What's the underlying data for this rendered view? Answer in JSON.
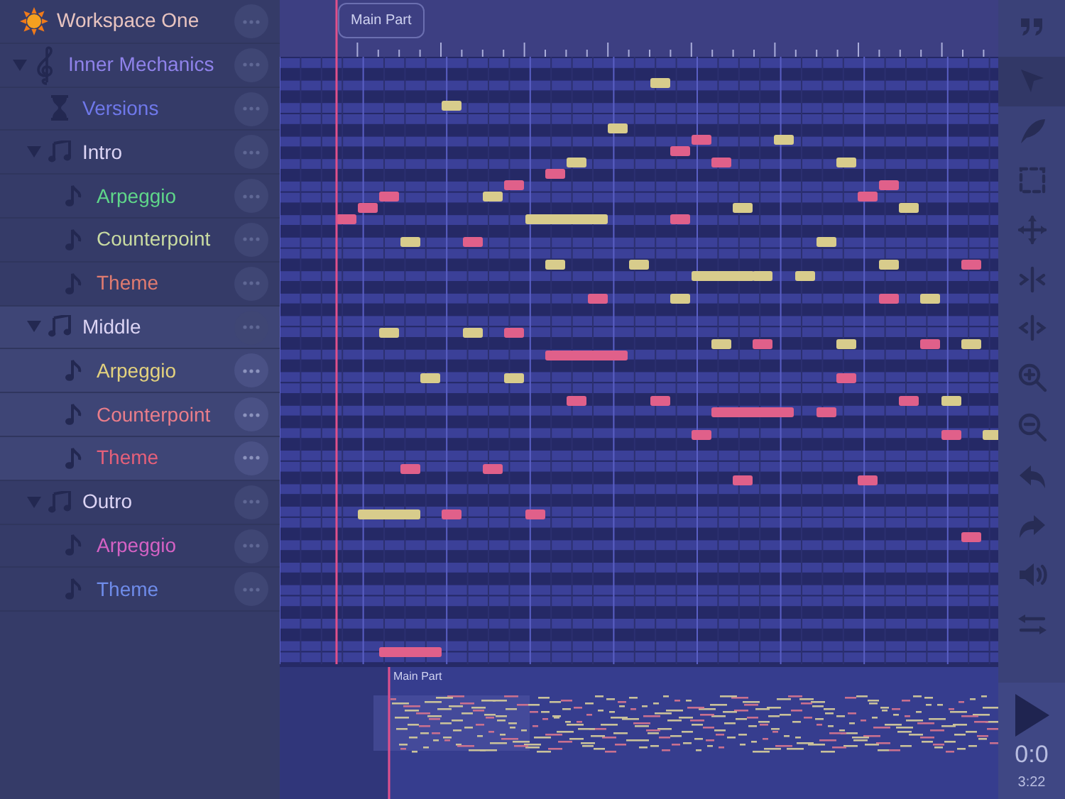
{
  "workspace": {
    "label": "Workspace One"
  },
  "tree": [
    {
      "label": "Inner Mechanics",
      "kind": "project",
      "color": "#8f82ea",
      "expanded": true,
      "children": [
        {
          "label": "Versions",
          "kind": "versions",
          "color": "#6f78ea"
        },
        {
          "label": "Intro",
          "kind": "section",
          "color": "#dcd4f4",
          "expanded": true,
          "selected": false,
          "children": [
            {
              "label": "Arpeggio",
              "kind": "track",
              "color": "#5fd68a"
            },
            {
              "label": "Counterpoint",
              "kind": "track",
              "color": "#c9dba2"
            },
            {
              "label": "Theme",
              "kind": "track",
              "color": "#e07b70"
            }
          ]
        },
        {
          "label": "Middle",
          "kind": "section",
          "color": "#dcd4f4",
          "expanded": true,
          "selected": true,
          "children": [
            {
              "label": "Arpeggio",
              "kind": "track",
              "color": "#e3d27e"
            },
            {
              "label": "Counterpoint",
              "kind": "track",
              "color": "#ea7d8a"
            },
            {
              "label": "Theme",
              "kind": "track",
              "color": "#e5607a"
            }
          ]
        },
        {
          "label": "Outro",
          "kind": "section",
          "color": "#dcd4f4",
          "expanded": true,
          "selected": false,
          "children": [
            {
              "label": "Arpeggio",
              "kind": "track",
              "color": "#d462c4"
            },
            {
              "label": "Theme",
              "kind": "track",
              "color": "#6f8cea"
            }
          ]
        }
      ]
    }
  ],
  "roll": {
    "part_label": "Main Part"
  },
  "overview": {
    "part_label": "Main Part"
  },
  "tools": [
    {
      "kind": "quote",
      "selected": false
    },
    {
      "kind": "pointer",
      "selected": true
    },
    {
      "kind": "pen",
      "selected": false
    },
    {
      "kind": "select",
      "selected": false
    },
    {
      "kind": "move",
      "selected": false
    },
    {
      "kind": "squeeze",
      "selected": false
    },
    {
      "kind": "stretch",
      "selected": false
    },
    {
      "kind": "zoom-in",
      "selected": false
    },
    {
      "kind": "zoom-out",
      "selected": false
    },
    {
      "kind": "undo",
      "selected": false
    },
    {
      "kind": "redo",
      "selected": false
    },
    {
      "kind": "volume",
      "selected": false
    },
    {
      "kind": "swap",
      "selected": false
    }
  ],
  "transport": {
    "time": "0:0",
    "duration": "3:22"
  }
}
